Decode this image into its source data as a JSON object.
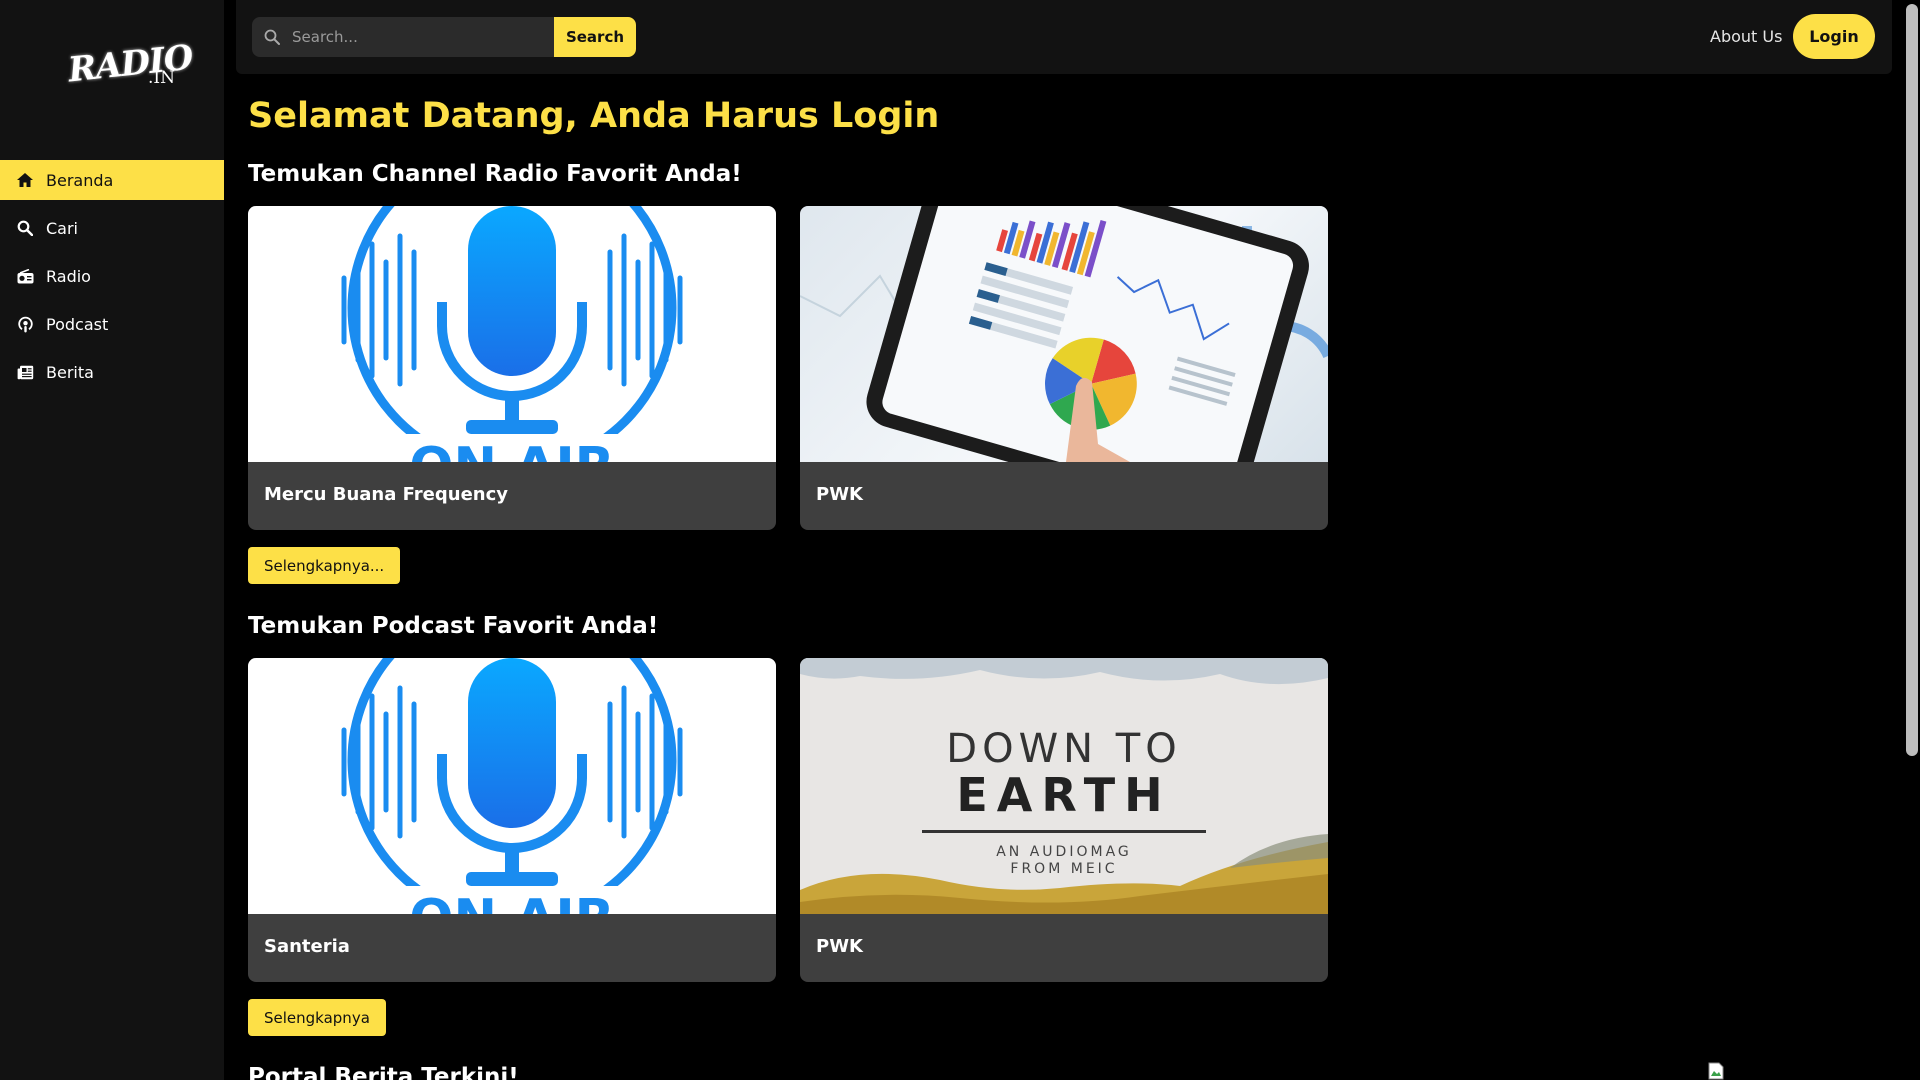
{
  "logo": {
    "main": "RADIO",
    "suffix": ".IN"
  },
  "sidebar": {
    "items": [
      {
        "label": "Beranda",
        "icon": "home-icon",
        "active": true
      },
      {
        "label": "Cari",
        "icon": "search-icon"
      },
      {
        "label": "Radio",
        "icon": "radio-icon"
      },
      {
        "label": "Podcast",
        "icon": "podcast-icon"
      },
      {
        "label": "Berita",
        "icon": "newspaper-icon"
      }
    ]
  },
  "header": {
    "search_placeholder": "Search...",
    "search_button": "Search",
    "about": "About Us",
    "login": "Login"
  },
  "main": {
    "welcome": "Selamat Datang, Anda Harus Login",
    "radio_section": {
      "title": "Temukan Channel Radio Favorit Anda!",
      "cards": [
        {
          "name": "Mercu Buana Frequency"
        },
        {
          "name": "PWK"
        }
      ],
      "more": "Selengkapnya..."
    },
    "podcast_section": {
      "title": "Temukan Podcast Favorit Anda!",
      "cards": [
        {
          "name": "Santeria"
        },
        {
          "name": "PWK",
          "cover_line1": "DOWN TO",
          "cover_line2": "EARTH",
          "cover_sub1": "AN AUDIOMAG",
          "cover_sub2": "FROM MEIC"
        }
      ],
      "more": "Selengkapnya"
    },
    "news_section": {
      "title": "Portal Berita Terkini!"
    }
  },
  "colors": {
    "accent": "#fde047",
    "sidebar_bg": "#121212",
    "card_bg": "#3f3f3f",
    "mic_blue": "#1a8cf0"
  }
}
